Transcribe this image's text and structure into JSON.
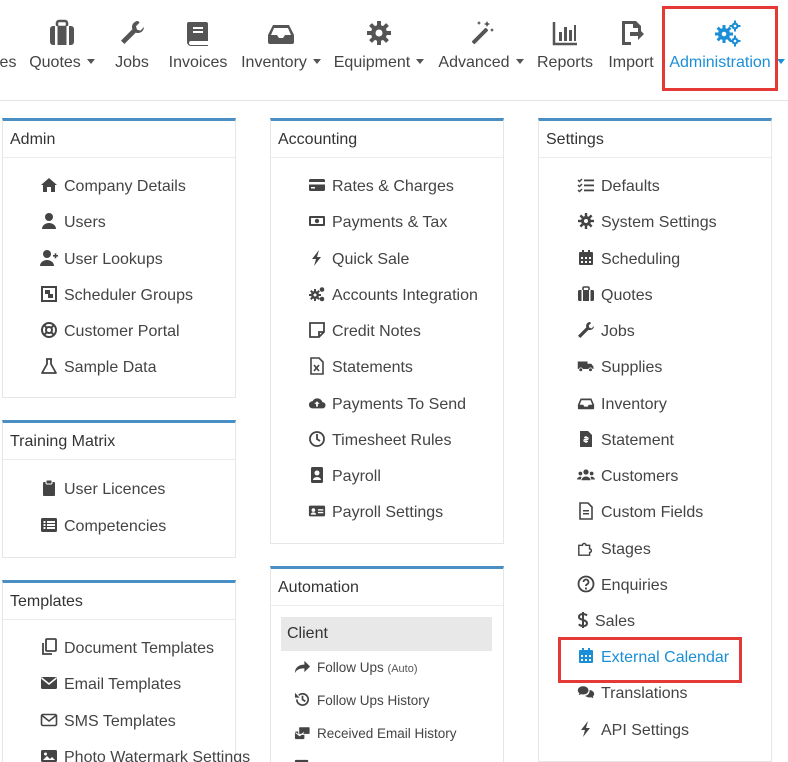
{
  "nav": {
    "partial": "es",
    "quotes": "Quotes",
    "jobs": "Jobs",
    "invoices": "Invoices",
    "inventory": "Inventory",
    "equipment": "Equipment",
    "advanced": "Advanced",
    "reports": "Reports",
    "import": "Import",
    "administration": "Administration"
  },
  "admin": {
    "title": "Admin",
    "items": [
      "Company Details",
      "Users",
      "User Lookups",
      "Scheduler Groups",
      "Customer Portal",
      "Sample Data"
    ]
  },
  "training": {
    "title": "Training Matrix",
    "items": [
      "User Licences",
      "Competencies"
    ]
  },
  "templates": {
    "title": "Templates",
    "items": [
      "Document Templates",
      "Email Templates",
      "SMS Templates",
      "Photo Watermark Settings"
    ]
  },
  "accounting": {
    "title": "Accounting",
    "items": [
      "Rates & Charges",
      "Payments & Tax",
      "Quick Sale",
      "Accounts Integration",
      "Credit Notes",
      "Statements",
      "Payments To Send",
      "Timesheet Rules",
      "Payroll",
      "Payroll Settings"
    ]
  },
  "automation": {
    "title": "Automation",
    "subheading": "Client",
    "items": [
      "Follow Ups",
      "Follow Ups History",
      "Received Email History"
    ],
    "auto_tag": "(Auto)"
  },
  "settings": {
    "title": "Settings",
    "items": [
      "Defaults",
      "System Settings",
      "Scheduling",
      "Quotes",
      "Jobs",
      "Supplies",
      "Inventory",
      "Statement",
      "Customers",
      "Custom Fields",
      "Stages",
      "Enquiries",
      "Sales",
      "External Calendar",
      "Translations",
      "API Settings"
    ]
  },
  "colors": {
    "accent": "#1a8fd8",
    "panel_border": "#4a8fc4",
    "highlight": "#e53935"
  }
}
